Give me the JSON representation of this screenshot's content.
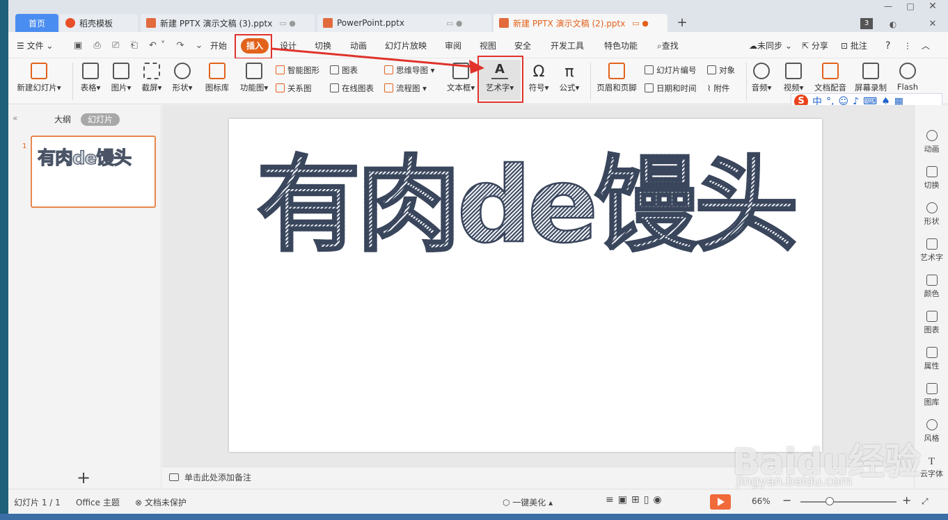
{
  "tabs": [
    {
      "label": "首页"
    },
    {
      "label": "稻壳模板"
    },
    {
      "label": "新建 PPTX 演示文稿 (3).pptx"
    },
    {
      "label": "PowerPoint.pptx"
    },
    {
      "label": "新建 PPTX 演示文稿 (2).pptx"
    }
  ],
  "tab_badge": "3",
  "menu": {
    "file": "文件",
    "items": [
      "开始",
      "插入",
      "设计",
      "切换",
      "动画",
      "幻灯片放映",
      "审阅",
      "视图",
      "安全",
      "开发工具",
      "特色功能"
    ],
    "search": "查找",
    "sync": "未同步",
    "share": "分享",
    "comment": "批注",
    "help": "?"
  },
  "ribbon": {
    "new_slide": "新建幻灯片",
    "table": "表格",
    "picture": "图片",
    "screenshot": "截屏",
    "shape": "形状",
    "icon_lib": "图标库",
    "function_chart": "功能图",
    "smart_shape": "智能图形",
    "chart": "图表",
    "mindmap": "思维导图",
    "relation": "关系图",
    "online_chart": "在线图表",
    "flowchart": "流程图",
    "textbox": "文本框",
    "wordart": "艺术字",
    "symbol": "符号",
    "formula": "公式",
    "header_footer": "页眉和页脚",
    "slide_number": "幻灯片编号",
    "object": "对象",
    "datetime": "日期和时间",
    "attachment": "附件",
    "audio": "音频",
    "video": "视频",
    "doc_voice": "文档配音",
    "screen_record": "屏幕录制",
    "flash": "Flash"
  },
  "ime": {
    "logo": "S",
    "lang": "中"
  },
  "left_panel": {
    "outline": "大纲",
    "slides": "幻灯片",
    "slide_number": "1",
    "thumb_text": "有肉de馒头"
  },
  "slide": {
    "wordart_text": "有肉de馒头"
  },
  "notes": {
    "placeholder": "单击此处添加备注"
  },
  "right_sidebar": [
    "动画",
    "切换",
    "形状",
    "艺术字",
    "颜色",
    "图表",
    "属性",
    "图库",
    "风格",
    "云字体"
  ],
  "status": {
    "slide_count": "幻灯片 1 / 1",
    "theme": "Office 主题",
    "protect": "文档未保护",
    "beautify": "一键美化",
    "zoom": "66%"
  },
  "watermark": {
    "brand": "Baidu经验",
    "url": "jingyan.baidu.com"
  },
  "colors": {
    "accent": "#e2621b",
    "highlight_box": "#e0322b",
    "home_tab": "#4a8df0"
  }
}
